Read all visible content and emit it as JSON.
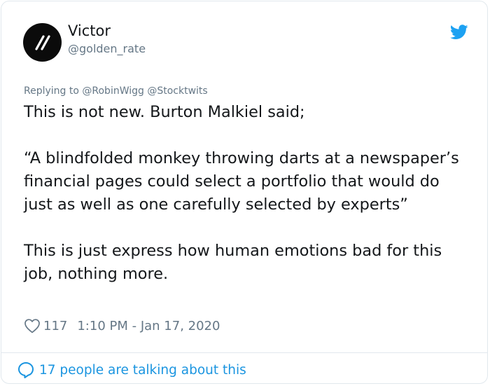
{
  "tweet": {
    "author": {
      "name": "Victor",
      "handle": "@golden_rate",
      "avatar_icon": "double-slash-logo-icon"
    },
    "platform_icon": "twitter-bird-icon",
    "brand_color": "#1da1f2",
    "replying": {
      "prefix": "Replying to",
      "mentions": [
        "@RobinWigg",
        "@Stocktwits"
      ]
    },
    "text": "This is not new. Burton Malkiel said;\n\n“A blindfolded monkey throwing darts at a newspaper’s financial pages could select a portfolio that would do just as well as one carefully selected by experts”\n\nThis is just express how human emotions bad for this job, nothing more.",
    "likes": "117",
    "timestamp": "1:10 PM - Jan 17, 2020",
    "footer": {
      "icon": "speech-bubble-icon",
      "label": "17 people are talking about this"
    }
  }
}
